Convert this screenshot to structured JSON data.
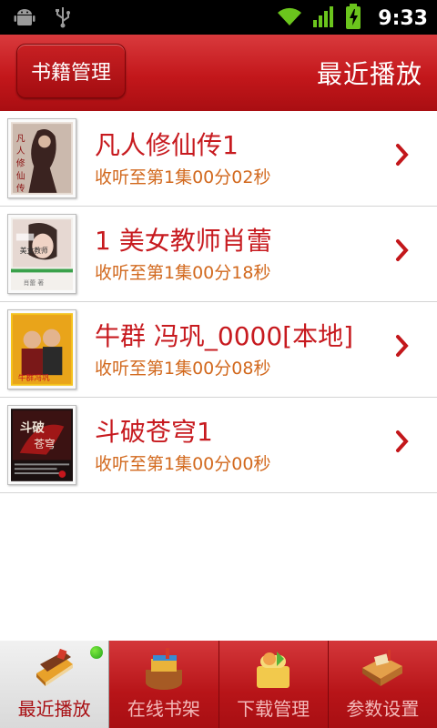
{
  "status_bar": {
    "time": "9:33"
  },
  "header": {
    "manage_button": "书籍管理",
    "title": "最近播放"
  },
  "books": [
    {
      "title": "凡人修仙传1",
      "progress": "收听至第1集00分02秒"
    },
    {
      "title": "1 美女教师肖蕾",
      "progress": "收听至第1集00分18秒"
    },
    {
      "title": "牛群 冯巩_0000[本地]",
      "progress": "收听至第1集00分08秒"
    },
    {
      "title": "斗破苍穹1",
      "progress": "收听至第1集00分00秒"
    }
  ],
  "tabs": [
    {
      "label": "最近播放",
      "icon": "books-icon",
      "active": true
    },
    {
      "label": "在线书架",
      "icon": "bookshelf-icon",
      "active": false
    },
    {
      "label": "下载管理",
      "icon": "download-icon",
      "active": false
    },
    {
      "label": "参数设置",
      "icon": "settings-desk-icon",
      "active": false
    }
  ],
  "colors": {
    "brand_red": "#c3171b",
    "title_red": "#c71a1f",
    "progress_orange": "#d2691e"
  }
}
